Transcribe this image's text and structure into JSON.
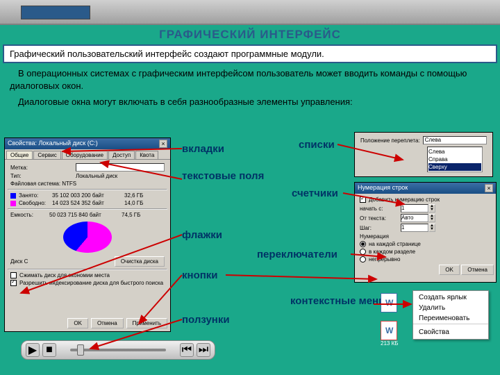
{
  "header": {
    "title": "ГРАФИЧЕСКИЙ ИНТЕРФЕЙС"
  },
  "intro": "Графический пользовательский интерфейс создают программные модули.",
  "para1": "В операционных системах с графическим интерфейсом пользователь может вводить команды с помощью диалоговых окон.",
  "para2": "Диалоговые окна могут включать в себя разнообразные элементы управления:",
  "labels": {
    "tabs": "вкладки",
    "textfields": "текстовые поля",
    "checkboxes": "флажки",
    "buttons": "кнопки",
    "sliders": "ползунки",
    "lists": "списки",
    "spinners": "счетчики",
    "radios": "переключатели",
    "context": "контекстные меню"
  },
  "dlg1": {
    "title": "Свойства: Локальный диск (C:)",
    "tabs": [
      "Общие",
      "Сервис",
      "Оборудование",
      "Доступ",
      "Квота"
    ],
    "name_label": "Метка:",
    "type_label": "Тип:",
    "type_val": "Локальный диск",
    "fs_label": "Файловая система: NTFS",
    "used_label": "Занято:",
    "used_b": "35 102 003 200 байт",
    "used_g": "32,6 ГБ",
    "free_label": "Свободно:",
    "free_b": "14 023 524 352 байт",
    "free_g": "14,0 ГБ",
    "cap_label": "Емкость:",
    "cap_b": "50 023 715 840 байт",
    "cap_g": "74,5 ГБ",
    "disk_label": "Диск C",
    "clean_btn": "Очистка диска",
    "comp_chk": "Сжимать диск для экономии места",
    "idx_chk": "Разрешить индексирование диска для быстрого поиска",
    "ok": "OK",
    "cancel": "Отмена",
    "apply": "Применить"
  },
  "list_panel": {
    "label": "Положение переплета:",
    "sel": "Слева",
    "items": [
      "Слева",
      "Справа",
      "Сверху"
    ]
  },
  "dlg2": {
    "title": "Нумерация строк",
    "add_chk": "Добавить нумерацию строк",
    "start_label": "начать с:",
    "from_label": "От текста:",
    "from_val": "Авто",
    "step_label": "Шаг:",
    "num_label": "Нумерация",
    "r1": "на каждой странице",
    "r2": "в каждом разделе",
    "r3": "непрерывно",
    "ok": "OK",
    "cancel": "Отмена"
  },
  "ctx": {
    "i1": "Создать ярлык",
    "i2": "Удалить",
    "i3": "Переименовать",
    "i4": "Свойства"
  },
  "file": {
    "size": "213 КБ"
  }
}
